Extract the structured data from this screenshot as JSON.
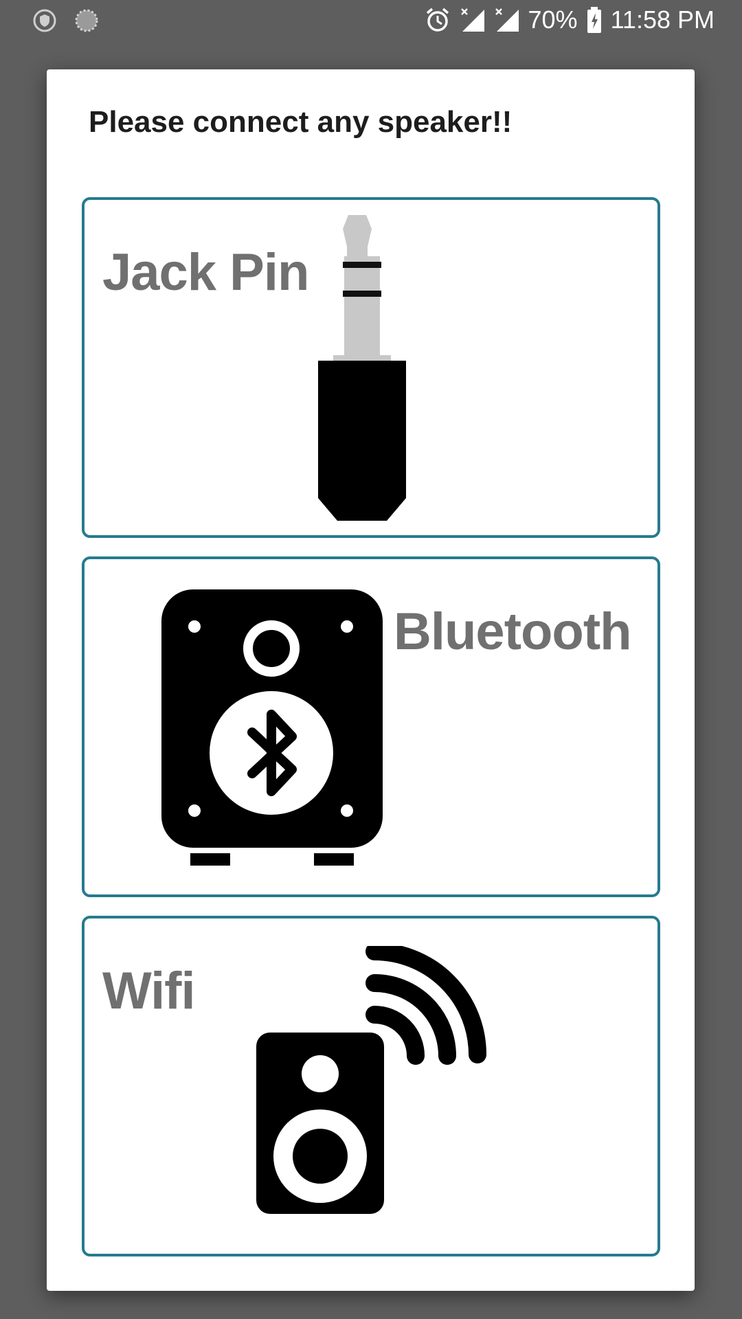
{
  "status_bar": {
    "battery": "70%",
    "time": "11:58 PM",
    "icons": [
      "shield-icon",
      "sync-icon",
      "alarm-icon",
      "signal-icon",
      "signal-icon",
      "battery-charging-icon"
    ]
  },
  "dialog": {
    "title": "Please connect any speaker!!",
    "options": [
      {
        "label": "Jack Pin",
        "icon": "audio-jack-icon"
      },
      {
        "label": "Bluetooth",
        "icon": "bluetooth-speaker-icon"
      },
      {
        "label": "Wifi",
        "icon": "wifi-speaker-icon"
      }
    ]
  },
  "colors": {
    "backdrop": "#5e5e5e",
    "card_border": "#267b8e",
    "label_text": "#707070"
  }
}
